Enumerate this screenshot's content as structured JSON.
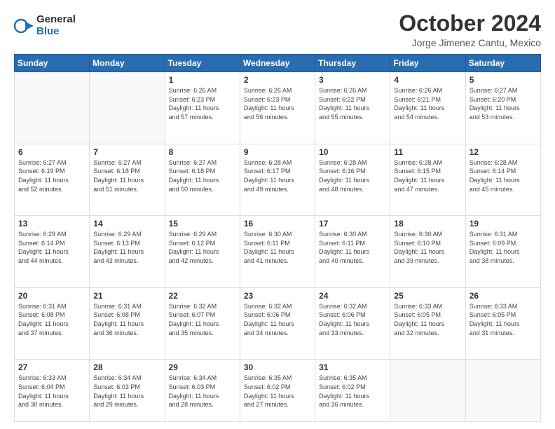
{
  "logo": {
    "general": "General",
    "blue": "Blue"
  },
  "title": {
    "month": "October 2024",
    "location": "Jorge Jimenez Cantu, Mexico"
  },
  "headers": [
    "Sunday",
    "Monday",
    "Tuesday",
    "Wednesday",
    "Thursday",
    "Friday",
    "Saturday"
  ],
  "weeks": [
    [
      {
        "day": "",
        "info": ""
      },
      {
        "day": "",
        "info": ""
      },
      {
        "day": "1",
        "info": "Sunrise: 6:26 AM\nSunset: 6:23 PM\nDaylight: 11 hours\nand 57 minutes."
      },
      {
        "day": "2",
        "info": "Sunrise: 6:26 AM\nSunset: 6:23 PM\nDaylight: 11 hours\nand 56 minutes."
      },
      {
        "day": "3",
        "info": "Sunrise: 6:26 AM\nSunset: 6:22 PM\nDaylight: 11 hours\nand 55 minutes."
      },
      {
        "day": "4",
        "info": "Sunrise: 6:26 AM\nSunset: 6:21 PM\nDaylight: 11 hours\nand 54 minutes."
      },
      {
        "day": "5",
        "info": "Sunrise: 6:27 AM\nSunset: 6:20 PM\nDaylight: 11 hours\nand 53 minutes."
      }
    ],
    [
      {
        "day": "6",
        "info": "Sunrise: 6:27 AM\nSunset: 6:19 PM\nDaylight: 11 hours\nand 52 minutes."
      },
      {
        "day": "7",
        "info": "Sunrise: 6:27 AM\nSunset: 6:18 PM\nDaylight: 11 hours\nand 51 minutes."
      },
      {
        "day": "8",
        "info": "Sunrise: 6:27 AM\nSunset: 6:18 PM\nDaylight: 11 hours\nand 50 minutes."
      },
      {
        "day": "9",
        "info": "Sunrise: 6:28 AM\nSunset: 6:17 PM\nDaylight: 11 hours\nand 49 minutes."
      },
      {
        "day": "10",
        "info": "Sunrise: 6:28 AM\nSunset: 6:16 PM\nDaylight: 11 hours\nand 48 minutes."
      },
      {
        "day": "11",
        "info": "Sunrise: 6:28 AM\nSunset: 6:15 PM\nDaylight: 11 hours\nand 47 minutes."
      },
      {
        "day": "12",
        "info": "Sunrise: 6:28 AM\nSunset: 6:14 PM\nDaylight: 11 hours\nand 45 minutes."
      }
    ],
    [
      {
        "day": "13",
        "info": "Sunrise: 6:29 AM\nSunset: 6:14 PM\nDaylight: 11 hours\nand 44 minutes."
      },
      {
        "day": "14",
        "info": "Sunrise: 6:29 AM\nSunset: 6:13 PM\nDaylight: 11 hours\nand 43 minutes."
      },
      {
        "day": "15",
        "info": "Sunrise: 6:29 AM\nSunset: 6:12 PM\nDaylight: 11 hours\nand 42 minutes."
      },
      {
        "day": "16",
        "info": "Sunrise: 6:30 AM\nSunset: 6:11 PM\nDaylight: 11 hours\nand 41 minutes."
      },
      {
        "day": "17",
        "info": "Sunrise: 6:30 AM\nSunset: 6:11 PM\nDaylight: 11 hours\nand 40 minutes."
      },
      {
        "day": "18",
        "info": "Sunrise: 6:30 AM\nSunset: 6:10 PM\nDaylight: 11 hours\nand 39 minutes."
      },
      {
        "day": "19",
        "info": "Sunrise: 6:31 AM\nSunset: 6:09 PM\nDaylight: 11 hours\nand 38 minutes."
      }
    ],
    [
      {
        "day": "20",
        "info": "Sunrise: 6:31 AM\nSunset: 6:08 PM\nDaylight: 11 hours\nand 37 minutes."
      },
      {
        "day": "21",
        "info": "Sunrise: 6:31 AM\nSunset: 6:08 PM\nDaylight: 11 hours\nand 36 minutes."
      },
      {
        "day": "22",
        "info": "Sunrise: 6:32 AM\nSunset: 6:07 PM\nDaylight: 11 hours\nand 35 minutes."
      },
      {
        "day": "23",
        "info": "Sunrise: 6:32 AM\nSunset: 6:06 PM\nDaylight: 11 hours\nand 34 minutes."
      },
      {
        "day": "24",
        "info": "Sunrise: 6:32 AM\nSunset: 6:06 PM\nDaylight: 11 hours\nand 33 minutes."
      },
      {
        "day": "25",
        "info": "Sunrise: 6:33 AM\nSunset: 6:05 PM\nDaylight: 11 hours\nand 32 minutes."
      },
      {
        "day": "26",
        "info": "Sunrise: 6:33 AM\nSunset: 6:05 PM\nDaylight: 11 hours\nand 31 minutes."
      }
    ],
    [
      {
        "day": "27",
        "info": "Sunrise: 6:33 AM\nSunset: 6:04 PM\nDaylight: 11 hours\nand 30 minutes."
      },
      {
        "day": "28",
        "info": "Sunrise: 6:34 AM\nSunset: 6:03 PM\nDaylight: 11 hours\nand 29 minutes."
      },
      {
        "day": "29",
        "info": "Sunrise: 6:34 AM\nSunset: 6:03 PM\nDaylight: 11 hours\nand 28 minutes."
      },
      {
        "day": "30",
        "info": "Sunrise: 6:35 AM\nSunset: 6:02 PM\nDaylight: 11 hours\nand 27 minutes."
      },
      {
        "day": "31",
        "info": "Sunrise: 6:35 AM\nSunset: 6:02 PM\nDaylight: 11 hours\nand 26 minutes."
      },
      {
        "day": "",
        "info": ""
      },
      {
        "day": "",
        "info": ""
      }
    ]
  ]
}
